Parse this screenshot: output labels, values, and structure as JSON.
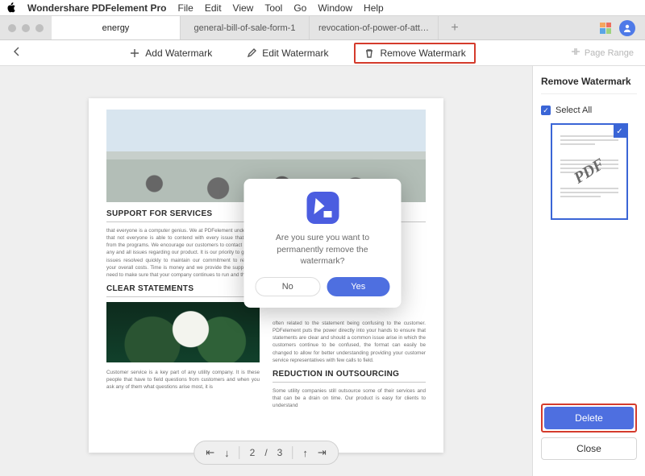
{
  "menubar": {
    "app": "Wondershare PDFelement Pro",
    "items": [
      "File",
      "Edit",
      "View",
      "Tool",
      "Go",
      "Window",
      "Help"
    ]
  },
  "tabs": {
    "items": [
      {
        "label": "energy",
        "active": true
      },
      {
        "label": "general-bill-of-sale-form-1",
        "active": false
      },
      {
        "label": "revocation-of-power-of-att…",
        "active": false
      }
    ],
    "add_label": "+"
  },
  "toolbar": {
    "add_label": "Add Watermark",
    "edit_label": "Edit Watermark",
    "remove_label": "Remove Watermark",
    "page_range_label": "Page Range"
  },
  "document": {
    "h1": "SUPPORT FOR SERVICES",
    "p1": "that everyone is a computer genius. We at PDFelement understand that not everyone is able to contend with every issue that arises from the programs. We encourage our customers to contact us with any and all issues regarding our product. It is our priority to get your issues resolved quickly to maintain our commitment to reducing your overall costs. Time is money and we provide the support you need to make sure that your company continues to run and thrive.",
    "h2": "CLEAR STATEMENTS",
    "p2": "Customer service is a key part of any utility company. It is these people that have to field questions from customers and when you ask any of them what questions arise most, it is",
    "p3": "often related to the statement being confusing to the customer. PDFelement puts the power directly into your hands to ensure that statements are clear and should a common issue arise in which the customers continue to be confused, the format can easily be changed to allow for better understanding providing your customer service representatives with few calls to field.",
    "h3": "REDUCTION IN OUTSOURCING",
    "p4": "Some utility companies still outsource some of their services and that can be a drain on time. Our product is easy for clients to understand"
  },
  "pager": {
    "current": "2",
    "sep": "/",
    "total": "3"
  },
  "rpanel": {
    "title": "Remove Watermark",
    "select_all": "Select All",
    "watermark_text": "PDF",
    "delete_label": "Delete",
    "close_label": "Close"
  },
  "modal": {
    "text": "Are you sure you want to permanently remove the watermark?",
    "no": "No",
    "yes": "Yes"
  }
}
